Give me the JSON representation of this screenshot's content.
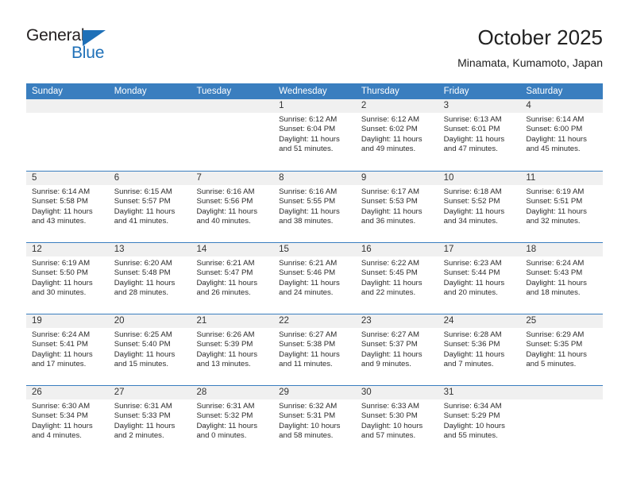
{
  "brand": {
    "name_top": "General",
    "name_bottom": "Blue",
    "accent_color": "#1e70b8"
  },
  "header": {
    "title": "October 2025",
    "subtitle": "Minamata, Kumamoto, Japan"
  },
  "calendar": {
    "header_color": "#3a7ebf",
    "daynum_band_color": "#f0f0f0",
    "day_names": [
      "Sunday",
      "Monday",
      "Tuesday",
      "Wednesday",
      "Thursday",
      "Friday",
      "Saturday"
    ],
    "weeks": [
      [
        {
          "day": "",
          "lines": []
        },
        {
          "day": "",
          "lines": []
        },
        {
          "day": "",
          "lines": []
        },
        {
          "day": "1",
          "lines": [
            "Sunrise: 6:12 AM",
            "Sunset: 6:04 PM",
            "Daylight: 11 hours",
            "and 51 minutes."
          ]
        },
        {
          "day": "2",
          "lines": [
            "Sunrise: 6:12 AM",
            "Sunset: 6:02 PM",
            "Daylight: 11 hours",
            "and 49 minutes."
          ]
        },
        {
          "day": "3",
          "lines": [
            "Sunrise: 6:13 AM",
            "Sunset: 6:01 PM",
            "Daylight: 11 hours",
            "and 47 minutes."
          ]
        },
        {
          "day": "4",
          "lines": [
            "Sunrise: 6:14 AM",
            "Sunset: 6:00 PM",
            "Daylight: 11 hours",
            "and 45 minutes."
          ]
        }
      ],
      [
        {
          "day": "5",
          "lines": [
            "Sunrise: 6:14 AM",
            "Sunset: 5:58 PM",
            "Daylight: 11 hours",
            "and 43 minutes."
          ]
        },
        {
          "day": "6",
          "lines": [
            "Sunrise: 6:15 AM",
            "Sunset: 5:57 PM",
            "Daylight: 11 hours",
            "and 41 minutes."
          ]
        },
        {
          "day": "7",
          "lines": [
            "Sunrise: 6:16 AM",
            "Sunset: 5:56 PM",
            "Daylight: 11 hours",
            "and 40 minutes."
          ]
        },
        {
          "day": "8",
          "lines": [
            "Sunrise: 6:16 AM",
            "Sunset: 5:55 PM",
            "Daylight: 11 hours",
            "and 38 minutes."
          ]
        },
        {
          "day": "9",
          "lines": [
            "Sunrise: 6:17 AM",
            "Sunset: 5:53 PM",
            "Daylight: 11 hours",
            "and 36 minutes."
          ]
        },
        {
          "day": "10",
          "lines": [
            "Sunrise: 6:18 AM",
            "Sunset: 5:52 PM",
            "Daylight: 11 hours",
            "and 34 minutes."
          ]
        },
        {
          "day": "11",
          "lines": [
            "Sunrise: 6:19 AM",
            "Sunset: 5:51 PM",
            "Daylight: 11 hours",
            "and 32 minutes."
          ]
        }
      ],
      [
        {
          "day": "12",
          "lines": [
            "Sunrise: 6:19 AM",
            "Sunset: 5:50 PM",
            "Daylight: 11 hours",
            "and 30 minutes."
          ]
        },
        {
          "day": "13",
          "lines": [
            "Sunrise: 6:20 AM",
            "Sunset: 5:48 PM",
            "Daylight: 11 hours",
            "and 28 minutes."
          ]
        },
        {
          "day": "14",
          "lines": [
            "Sunrise: 6:21 AM",
            "Sunset: 5:47 PM",
            "Daylight: 11 hours",
            "and 26 minutes."
          ]
        },
        {
          "day": "15",
          "lines": [
            "Sunrise: 6:21 AM",
            "Sunset: 5:46 PM",
            "Daylight: 11 hours",
            "and 24 minutes."
          ]
        },
        {
          "day": "16",
          "lines": [
            "Sunrise: 6:22 AM",
            "Sunset: 5:45 PM",
            "Daylight: 11 hours",
            "and 22 minutes."
          ]
        },
        {
          "day": "17",
          "lines": [
            "Sunrise: 6:23 AM",
            "Sunset: 5:44 PM",
            "Daylight: 11 hours",
            "and 20 minutes."
          ]
        },
        {
          "day": "18",
          "lines": [
            "Sunrise: 6:24 AM",
            "Sunset: 5:43 PM",
            "Daylight: 11 hours",
            "and 18 minutes."
          ]
        }
      ],
      [
        {
          "day": "19",
          "lines": [
            "Sunrise: 6:24 AM",
            "Sunset: 5:41 PM",
            "Daylight: 11 hours",
            "and 17 minutes."
          ]
        },
        {
          "day": "20",
          "lines": [
            "Sunrise: 6:25 AM",
            "Sunset: 5:40 PM",
            "Daylight: 11 hours",
            "and 15 minutes."
          ]
        },
        {
          "day": "21",
          "lines": [
            "Sunrise: 6:26 AM",
            "Sunset: 5:39 PM",
            "Daylight: 11 hours",
            "and 13 minutes."
          ]
        },
        {
          "day": "22",
          "lines": [
            "Sunrise: 6:27 AM",
            "Sunset: 5:38 PM",
            "Daylight: 11 hours",
            "and 11 minutes."
          ]
        },
        {
          "day": "23",
          "lines": [
            "Sunrise: 6:27 AM",
            "Sunset: 5:37 PM",
            "Daylight: 11 hours",
            "and 9 minutes."
          ]
        },
        {
          "day": "24",
          "lines": [
            "Sunrise: 6:28 AM",
            "Sunset: 5:36 PM",
            "Daylight: 11 hours",
            "and 7 minutes."
          ]
        },
        {
          "day": "25",
          "lines": [
            "Sunrise: 6:29 AM",
            "Sunset: 5:35 PM",
            "Daylight: 11 hours",
            "and 5 minutes."
          ]
        }
      ],
      [
        {
          "day": "26",
          "lines": [
            "Sunrise: 6:30 AM",
            "Sunset: 5:34 PM",
            "Daylight: 11 hours",
            "and 4 minutes."
          ]
        },
        {
          "day": "27",
          "lines": [
            "Sunrise: 6:31 AM",
            "Sunset: 5:33 PM",
            "Daylight: 11 hours",
            "and 2 minutes."
          ]
        },
        {
          "day": "28",
          "lines": [
            "Sunrise: 6:31 AM",
            "Sunset: 5:32 PM",
            "Daylight: 11 hours",
            "and 0 minutes."
          ]
        },
        {
          "day": "29",
          "lines": [
            "Sunrise: 6:32 AM",
            "Sunset: 5:31 PM",
            "Daylight: 10 hours",
            "and 58 minutes."
          ]
        },
        {
          "day": "30",
          "lines": [
            "Sunrise: 6:33 AM",
            "Sunset: 5:30 PM",
            "Daylight: 10 hours",
            "and 57 minutes."
          ]
        },
        {
          "day": "31",
          "lines": [
            "Sunrise: 6:34 AM",
            "Sunset: 5:29 PM",
            "Daylight: 10 hours",
            "and 55 minutes."
          ]
        },
        {
          "day": "",
          "lines": []
        }
      ]
    ]
  }
}
